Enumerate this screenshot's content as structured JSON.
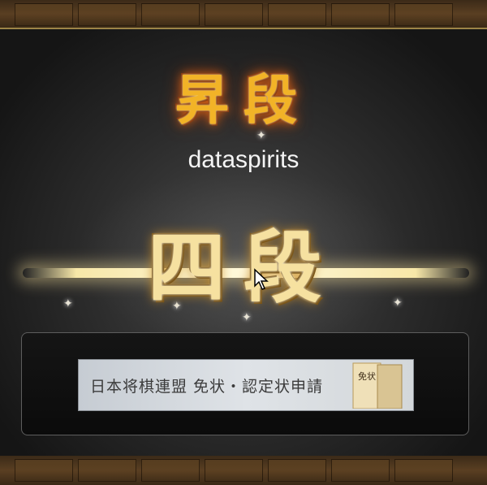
{
  "promotion_title": "昇段",
  "player_name": "dataspirits",
  "new_rank": "四段",
  "certificate": {
    "label": "日本将棋連盟 免状・認定状申請",
    "scroll_text": "免状"
  },
  "icons": {
    "cursor": "mouse-pointer-icon",
    "sparkle": "sparkle-icon",
    "scroll": "certificate-scroll-icon"
  },
  "colors": {
    "gold_title": "#f2b327",
    "rank_gold": "#f6e1a0",
    "panel_border": "#9c8447"
  }
}
